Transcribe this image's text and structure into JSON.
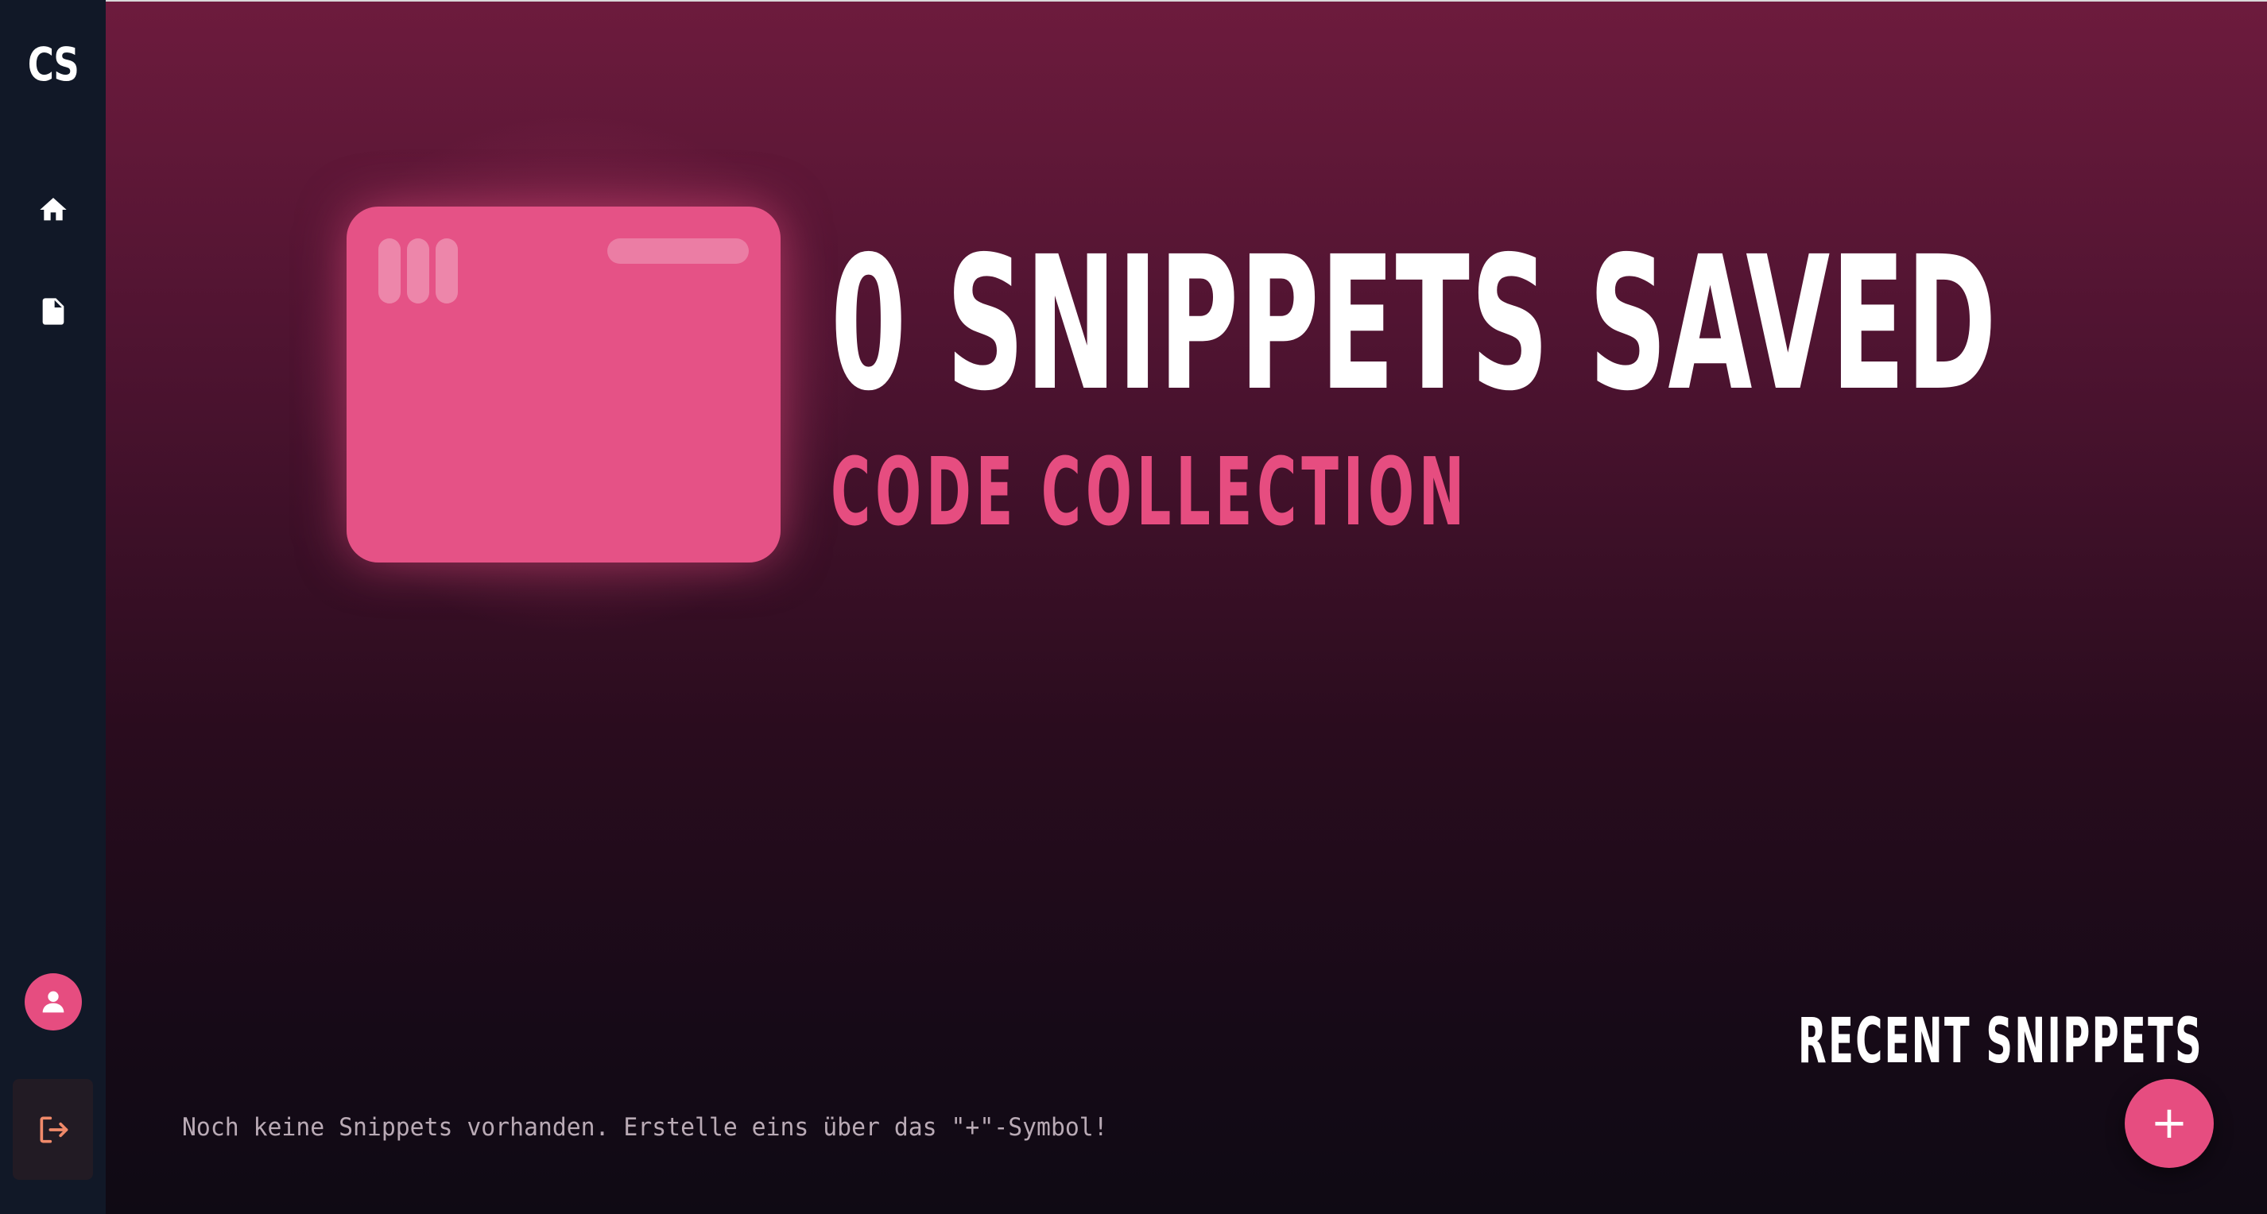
{
  "sidebar": {
    "logo_text": "CS",
    "nav": [
      {
        "icon": "home-icon"
      },
      {
        "icon": "document-icon"
      }
    ],
    "user_icon": "user-icon",
    "logout_icon": "logout-icon"
  },
  "hero": {
    "count": "0",
    "title": "0 SNIPPETS SAVED",
    "subtitle": "CODE COLLECTION",
    "illustration_icon": "code-window-icon"
  },
  "recent": {
    "title": "RECENT SNIPPETS",
    "empty_message": "Noch keine Snippets vorhanden. Erstelle eins über das \"+\"-Symbol!"
  },
  "fab": {
    "label": "+"
  },
  "colors": {
    "accent": "#e64d80",
    "sidebar_bg": "#111827",
    "bg_top": "#6d1b3d",
    "bg_bottom": "#0f0a14",
    "logout_icon": "#f08a6a"
  }
}
